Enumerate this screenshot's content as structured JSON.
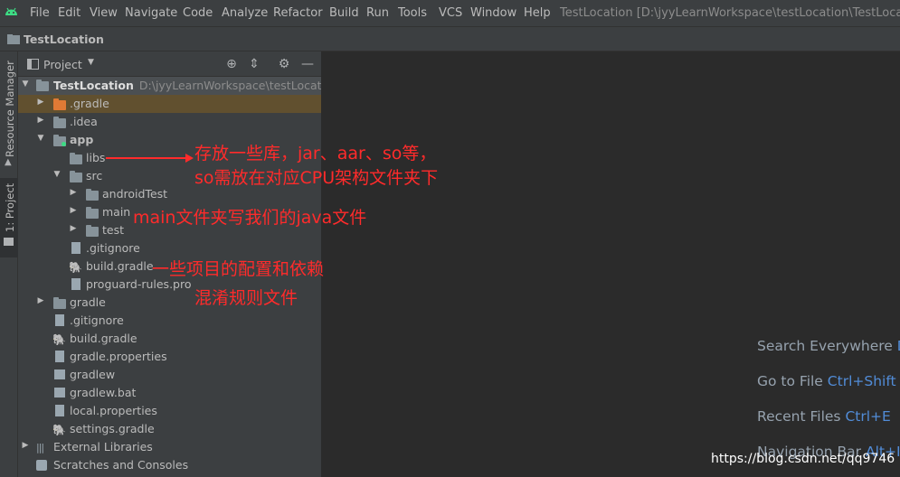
{
  "menubar": {
    "items": [
      "File",
      "Edit",
      "View",
      "Navigate",
      "Code",
      "Analyze",
      "Refactor",
      "Build",
      "Run",
      "Tools",
      "VCS",
      "Window",
      "Help"
    ],
    "title": "TestLocation [D:\\jyyLearnWorkspace\\testLocation\\TestLocation]"
  },
  "navbar": {
    "project": "TestLocation"
  },
  "side_tabs": {
    "resource_manager": "Resource Manager",
    "project": "1: Project"
  },
  "panel": {
    "title": "Project"
  },
  "tree": {
    "root": {
      "label": "TestLocation",
      "path": "D:\\jyyLearnWorkspace\\testLocation\\"
    },
    "gradle_dir": ".gradle",
    "idea": ".idea",
    "app": "app",
    "libs": "libs",
    "src": "src",
    "androidTest": "androidTest",
    "main": "main",
    "test": "test",
    "app_gitignore": ".gitignore",
    "app_build_gradle": "build.gradle",
    "proguard": "proguard-rules.pro",
    "gradle": "gradle",
    "gitignore": ".gitignore",
    "build_gradle": "build.gradle",
    "gradle_properties": "gradle.properties",
    "gradlew": "gradlew",
    "gradlew_bat": "gradlew.bat",
    "local_properties": "local.properties",
    "settings_gradle": "settings.gradle",
    "external_libraries": "External Libraries",
    "scratches": "Scratches and Consoles"
  },
  "editor_hints": [
    {
      "label": "Search Everywhere",
      "key": "D"
    },
    {
      "label": "Go to File",
      "key": "Ctrl+Shift"
    },
    {
      "label": "Recent Files",
      "key": "Ctrl+E"
    },
    {
      "label": "Navigation Bar",
      "key": "Alt+I"
    }
  ],
  "annotations": {
    "libs_note_line1": "存放一些库，jar、aar、so等，",
    "libs_note_line2": "so需放在对应CPU架构文件夹下",
    "main_note": "main文件夹写我们的java文件",
    "build_note": "一些项目的配置和依赖",
    "proguard_note": "混淆规则文件"
  },
  "watermark": "https://blog.csdn.net/qq9746",
  "colors": {
    "accent": "#589df6",
    "annotation": "#ff2b2b",
    "background": "#2b2b2b",
    "panel": "#3c3f41"
  }
}
